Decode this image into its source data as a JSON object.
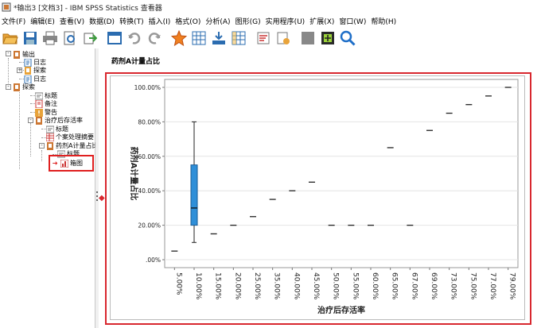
{
  "window": {
    "title": "*输出3 [文档3] - IBM SPSS Statistics 查看器"
  },
  "menu": [
    "文件(F)",
    "编辑(E)",
    "查看(V)",
    "数据(D)",
    "转换(T)",
    "插入(I)",
    "格式(O)",
    "分析(A)",
    "图形(G)",
    "实用程序(U)",
    "扩展(X)",
    "窗口(W)",
    "帮助(H)"
  ],
  "toolbar": [
    "open-icon",
    "save-icon",
    "print-icon",
    "print-preview-icon",
    "export-icon",
    "recall-dialog-icon",
    "undo-icon",
    "redo-icon",
    "goto-data-icon",
    "goto-case-icon",
    "goto-variable-icon",
    "variables-icon",
    "create-title-icon",
    "insert-text-icon",
    "hide-icon",
    "show-icon",
    "zoom-icon"
  ],
  "nav": {
    "items": [
      "输出",
      "日志",
      "探索",
      "日志",
      "探索",
      "标题",
      "备注",
      "警告",
      "治疗后存活率",
      "标题",
      "个案处理摘要",
      "药剂A计量占比",
      "标题",
      "箱图"
    ]
  },
  "output": {
    "title": "药剂A计量占比"
  },
  "chart_data": {
    "type": "scatter",
    "categories": [
      "5.00%",
      "10.00%",
      "15.00%",
      "20.00%",
      "25.00%",
      "35.00%",
      "40.00%",
      "45.00%",
      "50.00%",
      "55.00%",
      "60.00%",
      "65.00%",
      "67.00%",
      "69.00%",
      "73.00%",
      "75.00%",
      "77.00%",
      "79.00%"
    ],
    "values": [
      5,
      null,
      15,
      20,
      25,
      35,
      40,
      45,
      20,
      20,
      20,
      65,
      20,
      75,
      85,
      90,
      95,
      100
    ],
    "box": {
      "category": "10.00%",
      "min": 10,
      "q1": 20,
      "median": 30,
      "q3": 55,
      "max": 80
    },
    "xlabel": "治疗后存活率",
    "ylabel": "药剂A计量占比",
    "yticks": [
      "100.00%",
      "80.00%",
      "60.00%",
      "40.00%",
      "20.00%",
      ".00%"
    ],
    "ylim": [
      0,
      100
    ],
    "grid": true,
    "colors": {
      "box": "#2f8fd8",
      "frame": "#d8272e"
    }
  }
}
